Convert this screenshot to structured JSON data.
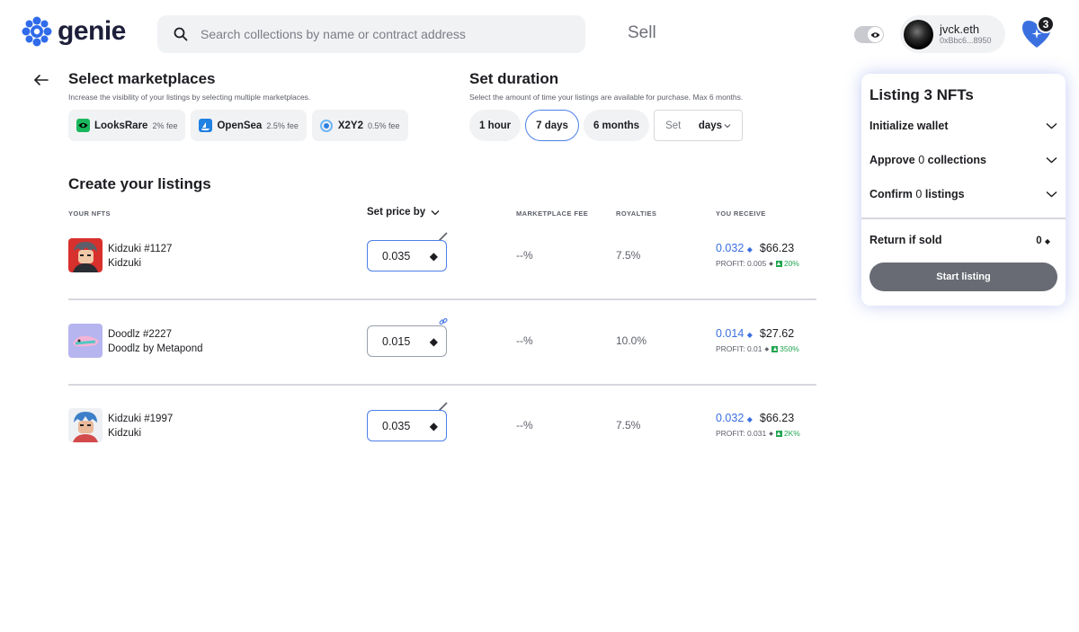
{
  "app": {
    "name": "genie",
    "accent": "#4c7fe8",
    "brand": "#2f6bea"
  },
  "header": {
    "search_placeholder": "Search collections by name or contract address",
    "nav_label": "Sell",
    "account_name": "jvck.eth",
    "account_address": "0xBbc6...8950",
    "bag_count": "3"
  },
  "marketplaces": {
    "title": "Select marketplaces",
    "subtitle": "Increase the visibility of your listings by selecting multiple marketplaces.",
    "items": [
      {
        "name": "LooksRare",
        "fee": "2% fee",
        "icon": "looksrare-icon"
      },
      {
        "name": "OpenSea",
        "fee": "2.5% fee",
        "icon": "opensea-icon"
      },
      {
        "name": "X2Y2",
        "fee": "0.5% fee",
        "icon": "x2y2-icon"
      }
    ]
  },
  "duration": {
    "title": "Set duration",
    "subtitle": "Select the amount of time your listings are available for purchase. Max 6 months.",
    "options": [
      "1 hour",
      "7 days",
      "6 months"
    ],
    "selected": "7 days",
    "custom_placeholder": "Set",
    "custom_unit": "days"
  },
  "listings": {
    "title": "Create your listings",
    "columns": {
      "nfts": "YOUR NFTS",
      "price": "Set price by",
      "fee": "MARKETPLACE FEE",
      "royalties": "ROYALTIES",
      "receive": "YOU RECEIVE"
    },
    "rows": [
      {
        "name": "Kidzuki #1127",
        "collection": "Kidzuki",
        "price": "0.035",
        "fee": "--%",
        "royalties": "7.5%",
        "receive_eth": "0.032",
        "receive_usd": "$66.23",
        "profit_label": "PROFIT: 0.005",
        "profit_pct": "20%",
        "tool": "pencil-icon"
      },
      {
        "name": "Doodlz #2227",
        "collection": "Doodlz by Metapond",
        "price": "0.015",
        "fee": "--%",
        "royalties": "10.0%",
        "receive_eth": "0.014",
        "receive_usd": "$27.62",
        "profit_label": "PROFIT: 0.01",
        "profit_pct": "350%",
        "tool": "link-icon"
      },
      {
        "name": "Kidzuki #1997",
        "collection": "Kidzuki",
        "price": "0.035",
        "fee": "--%",
        "royalties": "7.5%",
        "receive_eth": "0.032",
        "receive_usd": "$66.23",
        "profit_label": "PROFIT: 0.031",
        "profit_pct": "2K%",
        "tool": "pencil-icon"
      }
    ]
  },
  "panel": {
    "title": "Listing 3 NFTs",
    "steps": [
      {
        "label": "Initialize wallet",
        "count": ""
      },
      {
        "label": "Approve",
        "count": "0",
        "suffix": "collections"
      },
      {
        "label": "Confirm",
        "count": "0",
        "suffix": "listings"
      }
    ],
    "return_label": "Return if sold",
    "return_value": "0",
    "button_label": "Start listing"
  }
}
